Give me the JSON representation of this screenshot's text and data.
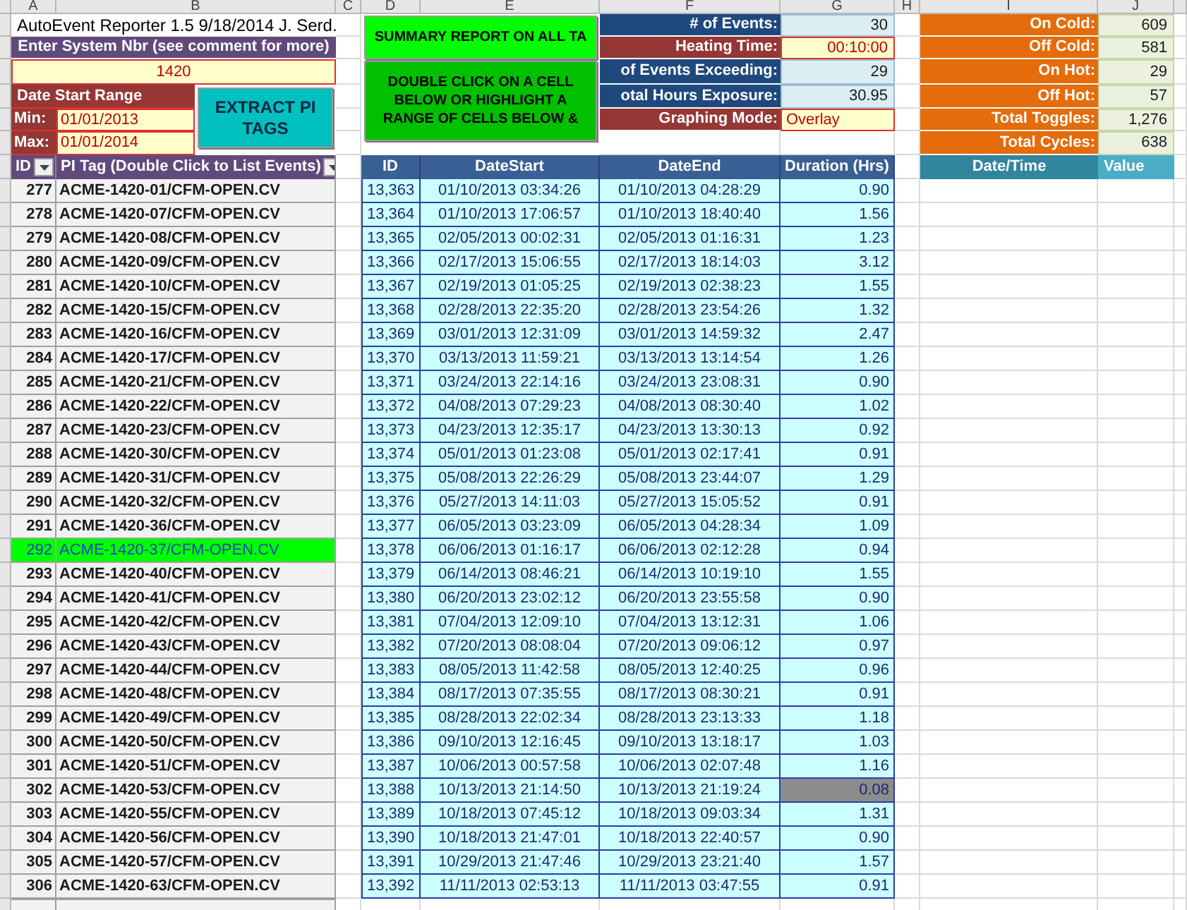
{
  "column_headers": [
    "A",
    "B",
    "C",
    "D",
    "E",
    "F",
    "G",
    "H",
    "I",
    "J"
  ],
  "title": "AutoEvent Reporter 1.5 9/18/2014 J. Serd.",
  "system_prompt": "Enter System Nbr (see comment for more)",
  "system_number": "1420",
  "date_range": {
    "label": "Date Start Range",
    "min_label": "Min:",
    "min": "01/01/2013",
    "max_label": "Max:",
    "max": "01/01/2014"
  },
  "buttons": [
    {
      "kind": "summary",
      "label": "SUMMARY REPORT ON ALL TA"
    },
    {
      "kind": "instructions",
      "label": "DOUBLE CLICK ON A CELL BELOW OR HIGHLIGHT A RANGE OF CELLS BELOW &"
    },
    {
      "kind": "extract",
      "label": "EXTRACT PI TAGS"
    }
  ],
  "event_stats": [
    {
      "label": "# of Events:",
      "value": "30",
      "kind": "computed"
    },
    {
      "label": "Heating Time:",
      "value": "00:10:00",
      "kind": "input"
    },
    {
      "label": "of Events Exceeding:",
      "value": "29",
      "kind": "computed"
    },
    {
      "label": "otal Hours Exposure:",
      "value": "30.95",
      "kind": "computed"
    },
    {
      "label": "Graphing Mode:",
      "value": "Overlay",
      "kind": "input"
    }
  ],
  "cycle_stats": [
    {
      "label": "On Cold:",
      "value": "609"
    },
    {
      "label": "Off Cold:",
      "value": "581"
    },
    {
      "label": "On Hot:",
      "value": "29"
    },
    {
      "label": "Off Hot:",
      "value": "57"
    },
    {
      "label": "Total Toggles:",
      "value": "1,276"
    },
    {
      "label": "Total Cycles:",
      "value": "638"
    }
  ],
  "pi_tags": {
    "columns": [
      "ID",
      "PI Tag (Double Click to List Events)"
    ],
    "rows": [
      {
        "id": "277",
        "tag": "ACME-1420-01/CFM-OPEN.CV",
        "selected": false
      },
      {
        "id": "278",
        "tag": "ACME-1420-07/CFM-OPEN.CV",
        "selected": false
      },
      {
        "id": "279",
        "tag": "ACME-1420-08/CFM-OPEN.CV",
        "selected": false
      },
      {
        "id": "280",
        "tag": "ACME-1420-09/CFM-OPEN.CV",
        "selected": false
      },
      {
        "id": "281",
        "tag": "ACME-1420-10/CFM-OPEN.CV",
        "selected": false
      },
      {
        "id": "282",
        "tag": "ACME-1420-15/CFM-OPEN.CV",
        "selected": false
      },
      {
        "id": "283",
        "tag": "ACME-1420-16/CFM-OPEN.CV",
        "selected": false
      },
      {
        "id": "284",
        "tag": "ACME-1420-17/CFM-OPEN.CV",
        "selected": false
      },
      {
        "id": "285",
        "tag": "ACME-1420-21/CFM-OPEN.CV",
        "selected": false
      },
      {
        "id": "286",
        "tag": "ACME-1420-22/CFM-OPEN.CV",
        "selected": false
      },
      {
        "id": "287",
        "tag": "ACME-1420-23/CFM-OPEN.CV",
        "selected": false
      },
      {
        "id": "288",
        "tag": "ACME-1420-30/CFM-OPEN.CV",
        "selected": false
      },
      {
        "id": "289",
        "tag": "ACME-1420-31/CFM-OPEN.CV",
        "selected": false
      },
      {
        "id": "290",
        "tag": "ACME-1420-32/CFM-OPEN.CV",
        "selected": false
      },
      {
        "id": "291",
        "tag": "ACME-1420-36/CFM-OPEN.CV",
        "selected": false
      },
      {
        "id": "292",
        "tag": "ACME-1420-37/CFM-OPEN.CV",
        "selected": true
      },
      {
        "id": "293",
        "tag": "ACME-1420-40/CFM-OPEN.CV",
        "selected": false
      },
      {
        "id": "294",
        "tag": "ACME-1420-41/CFM-OPEN.CV",
        "selected": false
      },
      {
        "id": "295",
        "tag": "ACME-1420-42/CFM-OPEN.CV",
        "selected": false
      },
      {
        "id": "296",
        "tag": "ACME-1420-43/CFM-OPEN.CV",
        "selected": false
      },
      {
        "id": "297",
        "tag": "ACME-1420-44/CFM-OPEN.CV",
        "selected": false
      },
      {
        "id": "298",
        "tag": "ACME-1420-48/CFM-OPEN.CV",
        "selected": false
      },
      {
        "id": "299",
        "tag": "ACME-1420-49/CFM-OPEN.CV",
        "selected": false
      },
      {
        "id": "300",
        "tag": "ACME-1420-50/CFM-OPEN.CV",
        "selected": false
      },
      {
        "id": "301",
        "tag": "ACME-1420-51/CFM-OPEN.CV",
        "selected": false
      },
      {
        "id": "302",
        "tag": "ACME-1420-53/CFM-OPEN.CV",
        "selected": false
      },
      {
        "id": "303",
        "tag": "ACME-1420-55/CFM-OPEN.CV",
        "selected": false
      },
      {
        "id": "304",
        "tag": "ACME-1420-56/CFM-OPEN.CV",
        "selected": false
      },
      {
        "id": "305",
        "tag": "ACME-1420-57/CFM-OPEN.CV",
        "selected": false
      },
      {
        "id": "306",
        "tag": "ACME-1420-63/CFM-OPEN.CV",
        "selected": false
      }
    ]
  },
  "events": {
    "columns": [
      "ID",
      "DateStart",
      "DateEnd",
      "Duration (Hrs)"
    ],
    "rows": [
      {
        "id": "13,363",
        "start": "01/10/2013 03:34:26",
        "end": "01/10/2013 04:28:29",
        "duration": "0.90",
        "flagged": false
      },
      {
        "id": "13,364",
        "start": "01/10/2013 17:06:57",
        "end": "01/10/2013 18:40:40",
        "duration": "1.56",
        "flagged": false
      },
      {
        "id": "13,365",
        "start": "02/05/2013 00:02:31",
        "end": "02/05/2013 01:16:31",
        "duration": "1.23",
        "flagged": false
      },
      {
        "id": "13,366",
        "start": "02/17/2013 15:06:55",
        "end": "02/17/2013 18:14:03",
        "duration": "3.12",
        "flagged": false
      },
      {
        "id": "13,367",
        "start": "02/19/2013 01:05:25",
        "end": "02/19/2013 02:38:23",
        "duration": "1.55",
        "flagged": false
      },
      {
        "id": "13,368",
        "start": "02/28/2013 22:35:20",
        "end": "02/28/2013 23:54:26",
        "duration": "1.32",
        "flagged": false
      },
      {
        "id": "13,369",
        "start": "03/01/2013 12:31:09",
        "end": "03/01/2013 14:59:32",
        "duration": "2.47",
        "flagged": false
      },
      {
        "id": "13,370",
        "start": "03/13/2013 11:59:21",
        "end": "03/13/2013 13:14:54",
        "duration": "1.26",
        "flagged": false
      },
      {
        "id": "13,371",
        "start": "03/24/2013 22:14:16",
        "end": "03/24/2013 23:08:31",
        "duration": "0.90",
        "flagged": false
      },
      {
        "id": "13,372",
        "start": "04/08/2013 07:29:23",
        "end": "04/08/2013 08:30:40",
        "duration": "1.02",
        "flagged": false
      },
      {
        "id": "13,373",
        "start": "04/23/2013 12:35:17",
        "end": "04/23/2013 13:30:13",
        "duration": "0.92",
        "flagged": false
      },
      {
        "id": "13,374",
        "start": "05/01/2013 01:23:08",
        "end": "05/01/2013 02:17:41",
        "duration": "0.91",
        "flagged": false
      },
      {
        "id": "13,375",
        "start": "05/08/2013 22:26:29",
        "end": "05/08/2013 23:44:07",
        "duration": "1.29",
        "flagged": false
      },
      {
        "id": "13,376",
        "start": "05/27/2013 14:11:03",
        "end": "05/27/2013 15:05:52",
        "duration": "0.91",
        "flagged": false
      },
      {
        "id": "13,377",
        "start": "06/05/2013 03:23:09",
        "end": "06/05/2013 04:28:34",
        "duration": "1.09",
        "flagged": false
      },
      {
        "id": "13,378",
        "start": "06/06/2013 01:16:17",
        "end": "06/06/2013 02:12:28",
        "duration": "0.94",
        "flagged": false
      },
      {
        "id": "13,379",
        "start": "06/14/2013 08:46:21",
        "end": "06/14/2013 10:19:10",
        "duration": "1.55",
        "flagged": false
      },
      {
        "id": "13,380",
        "start": "06/20/2013 23:02:12",
        "end": "06/20/2013 23:55:58",
        "duration": "0.90",
        "flagged": false
      },
      {
        "id": "13,381",
        "start": "07/04/2013 12:09:10",
        "end": "07/04/2013 13:12:31",
        "duration": "1.06",
        "flagged": false
      },
      {
        "id": "13,382",
        "start": "07/20/2013 08:08:04",
        "end": "07/20/2013 09:06:12",
        "duration": "0.97",
        "flagged": false
      },
      {
        "id": "13,383",
        "start": "08/05/2013 11:42:58",
        "end": "08/05/2013 12:40:25",
        "duration": "0.96",
        "flagged": false
      },
      {
        "id": "13,384",
        "start": "08/17/2013 07:35:55",
        "end": "08/17/2013 08:30:21",
        "duration": "0.91",
        "flagged": false
      },
      {
        "id": "13,385",
        "start": "08/28/2013 22:02:34",
        "end": "08/28/2013 23:13:33",
        "duration": "1.18",
        "flagged": false
      },
      {
        "id": "13,386",
        "start": "09/10/2013 12:16:45",
        "end": "09/10/2013 13:18:17",
        "duration": "1.03",
        "flagged": false
      },
      {
        "id": "13,387",
        "start": "10/06/2013 00:57:58",
        "end": "10/06/2013 02:07:48",
        "duration": "1.16",
        "flagged": false
      },
      {
        "id": "13,388",
        "start": "10/13/2013 21:14:50",
        "end": "10/13/2013 21:19:24",
        "duration": "0.08",
        "flagged": true
      },
      {
        "id": "13,389",
        "start": "10/18/2013 07:45:12",
        "end": "10/18/2013 09:03:34",
        "duration": "1.31",
        "flagged": false
      },
      {
        "id": "13,390",
        "start": "10/18/2013 21:47:01",
        "end": "10/18/2013 22:40:57",
        "duration": "0.90",
        "flagged": false
      },
      {
        "id": "13,391",
        "start": "10/29/2013 21:47:46",
        "end": "10/29/2013 23:21:40",
        "duration": "1.57",
        "flagged": false
      },
      {
        "id": "13,392",
        "start": "11/11/2013 02:53:13",
        "end": "11/11/2013 03:47:55",
        "duration": "0.91",
        "flagged": false
      }
    ]
  },
  "value_table": {
    "columns": [
      "Date/Time",
      "Value"
    ]
  }
}
